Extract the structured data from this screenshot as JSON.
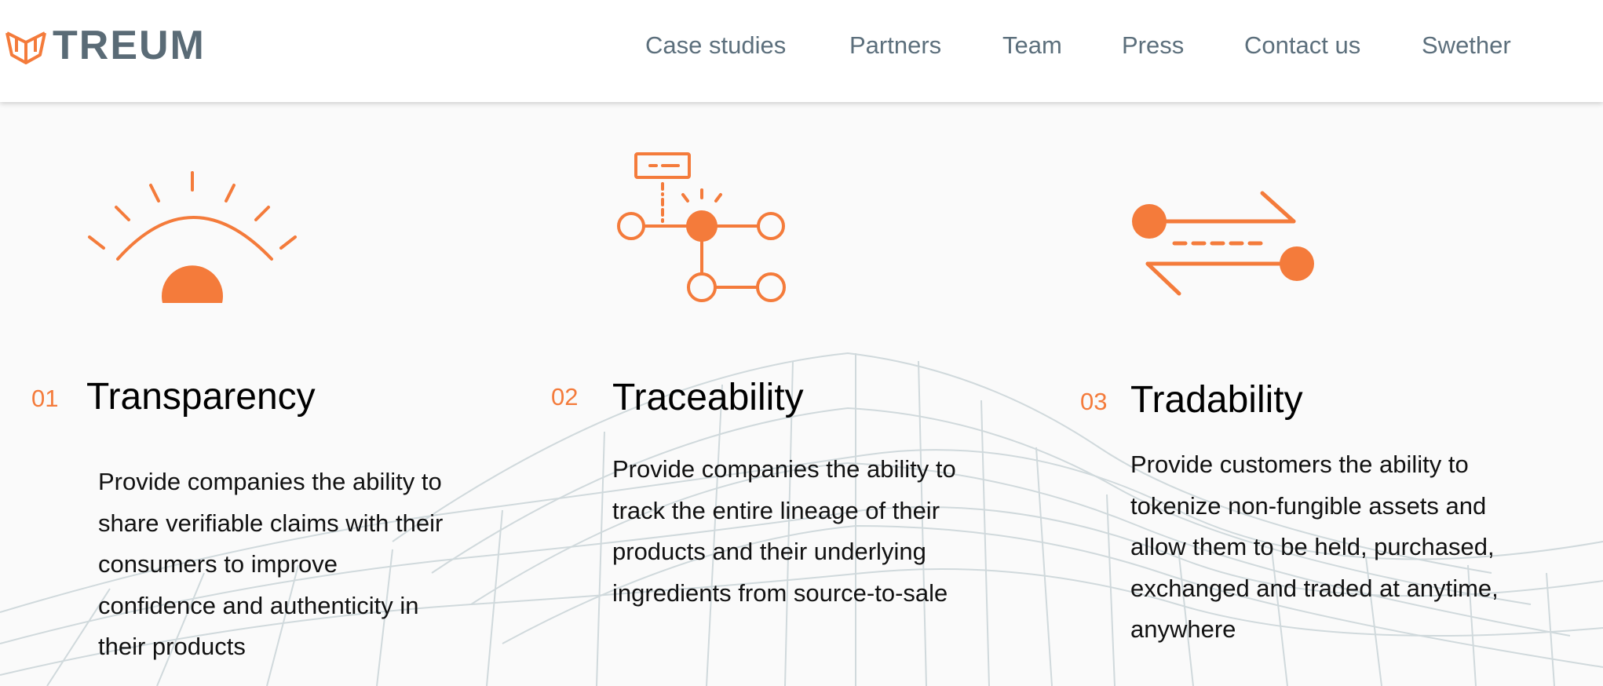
{
  "brand": {
    "name": "TREUM"
  },
  "nav": {
    "items": [
      "Case studies",
      "Partners",
      "Team",
      "Press",
      "Contact us",
      "Swether"
    ]
  },
  "features": [
    {
      "number": "01",
      "title": "Transparency",
      "description": "Provide companies the ability to share verifiable claims with their consumers to improve confidence and authenticity in their products",
      "icon": "eye-icon"
    },
    {
      "number": "02",
      "title": "Traceability",
      "description": "Provide companies the ability to track the entire lineage of their products and their underlying ingredients from source-to-sale",
      "icon": "node-tree-icon"
    },
    {
      "number": "03",
      "title": "Tradability",
      "description": "Provide customers the ability to tokenize non-fungible assets and allow them to be held, purchased, exchanged and traded at anytime, anywhere",
      "icon": "exchange-arrows-icon"
    }
  ],
  "colors": {
    "accent": "#f47b3b",
    "nav_text": "#5c6f7c",
    "mesh": "#d0d9dc"
  }
}
